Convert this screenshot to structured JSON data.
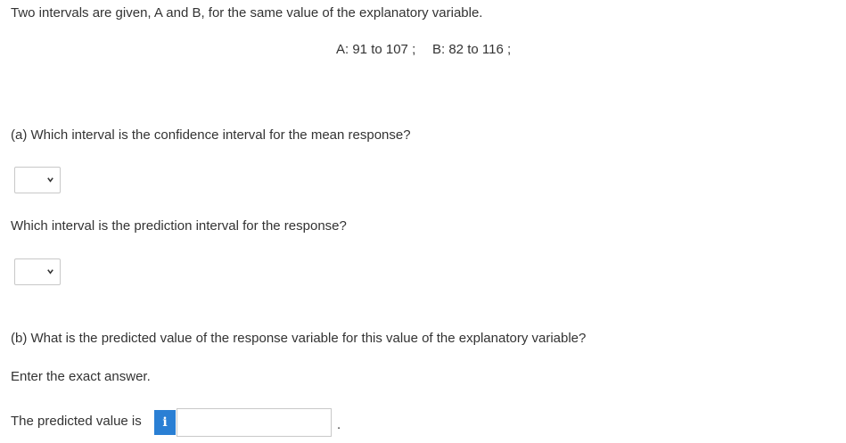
{
  "intro": "Two intervals are given, A and B, for the same value of the explanatory variable.",
  "intervals": {
    "a": "A: 91 to 107 ;",
    "b": "B: 82 to 116 ;"
  },
  "part_a": {
    "question1": "(a) Which interval is the confidence interval for the mean response?",
    "dropdown1_value": "",
    "question2": "Which interval is the prediction interval for the response?",
    "dropdown2_value": ""
  },
  "part_b": {
    "question": "(b) What is the predicted value of the response variable for this value of the explanatory variable?",
    "instruction": "Enter the exact answer.",
    "answer_label": "The predicted value is",
    "info_icon_glyph": "i",
    "answer_value": "",
    "trailing_punct": "."
  },
  "colors": {
    "text": "#333333",
    "info_button": "#2a7fd4",
    "border": "#c8c8c8"
  },
  "icons": {
    "dropdown": "chevron-down-icon",
    "info": "info-icon"
  }
}
